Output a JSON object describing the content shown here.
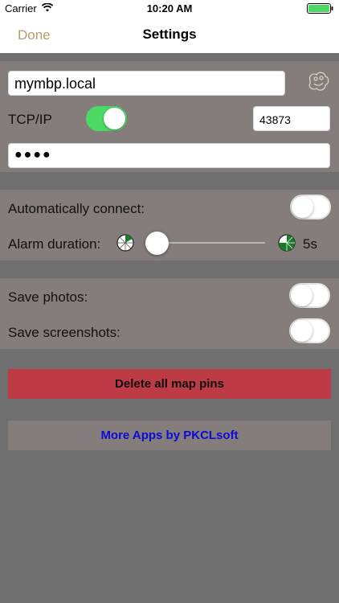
{
  "status_bar": {
    "carrier": "Carrier",
    "time": "10:20 AM"
  },
  "nav": {
    "done_label": "Done",
    "title": "Settings"
  },
  "connection": {
    "host": "mymbp.local",
    "protocol_label": "TCP/IP",
    "protocol_enabled": true,
    "port": "43873",
    "password_mask": "●●●●"
  },
  "options": {
    "auto_connect_label": "Automatically connect:",
    "auto_connect_enabled": false,
    "alarm_duration_label": "Alarm duration:",
    "alarm_duration_value": "5s"
  },
  "saving": {
    "save_photos_label": "Save photos:",
    "save_photos_enabled": false,
    "save_screenshots_label": "Save screenshots:",
    "save_screenshots_enabled": false
  },
  "actions": {
    "delete_pins_label": "Delete all map pins",
    "more_apps_label": "More Apps by PKCLsoft"
  },
  "colors": {
    "accent_done": "#b79a6c",
    "toggle_on": "#4cd964",
    "delete_button": "#bd3b45",
    "more_apps_text": "#0b0ad6",
    "group_bg": "#857d7b",
    "page_bg": "#6f6f6f"
  },
  "icons": [
    "wifi-icon",
    "battery-icon",
    "app-logo-icon",
    "clock-short-icon",
    "clock-long-icon"
  ]
}
